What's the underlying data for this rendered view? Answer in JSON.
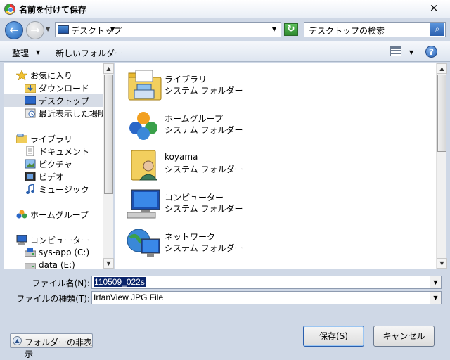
{
  "window": {
    "title": "名前を付けて保存",
    "close": "×"
  },
  "address": {
    "path": "デスクトップ",
    "search_placeholder": "デスクトップの検索"
  },
  "toolbar": {
    "organize": "整理",
    "new_folder": "新しいフォルダー",
    "help": "?"
  },
  "nav": {
    "items": [
      {
        "label": "お気に入り",
        "icon": "star-icon"
      },
      {
        "label": "ダウンロード",
        "icon": "download-folder-icon"
      },
      {
        "label": "デスクトップ",
        "icon": "desktop-icon",
        "selected": true
      },
      {
        "label": "最近表示した場所",
        "icon": "recent-places-icon"
      },
      {
        "label": "ライブラリ",
        "icon": "library-icon"
      },
      {
        "label": "ドキュメント",
        "icon": "documents-icon"
      },
      {
        "label": "ピクチャ",
        "icon": "pictures-icon"
      },
      {
        "label": "ビデオ",
        "icon": "videos-icon"
      },
      {
        "label": "ミュージック",
        "icon": "music-icon"
      },
      {
        "label": "ホームグループ",
        "icon": "homegroup-icon"
      },
      {
        "label": "コンピューター",
        "icon": "computer-icon"
      },
      {
        "label": "sys-app (C:)",
        "icon": "drive-icon"
      },
      {
        "label": "data (E:)",
        "icon": "drive-icon"
      }
    ]
  },
  "files": [
    {
      "name": "ライブラリ",
      "type": "システム フォルダー",
      "icon": "library-folder-icon"
    },
    {
      "name": "ホームグループ",
      "type": "システム フォルダー",
      "icon": "homegroup-icon"
    },
    {
      "name": "koyama",
      "type": "システム フォルダー",
      "icon": "user-folder-icon"
    },
    {
      "name": "コンピューター",
      "type": "システム フォルダー",
      "icon": "computer-icon"
    },
    {
      "name": "ネットワーク",
      "type": "システム フォルダー",
      "icon": "network-icon"
    }
  ],
  "form": {
    "filename_label": "ファイル名(N):",
    "filename_value": "110509_022s",
    "filetype_label": "ファイルの種類(T):",
    "filetype_value": "IrfanView JPG File"
  },
  "buttons": {
    "hide_folders": "フォルダーの非表示",
    "save": "保存(S)",
    "cancel": "キャンセル"
  }
}
